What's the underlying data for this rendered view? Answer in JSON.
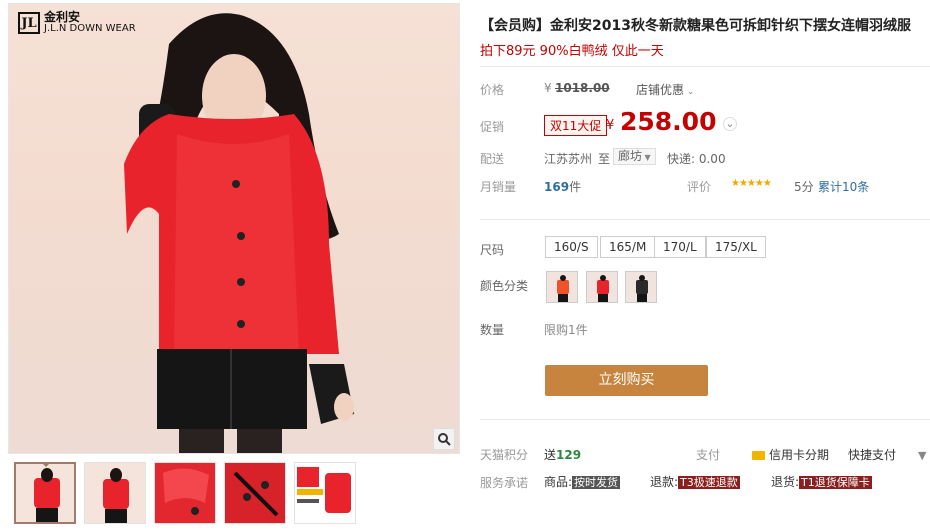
{
  "brand": {
    "mark": "JL",
    "cn": "金利安",
    "en": "J.L.N DOWN WEAR"
  },
  "title": "【会员购】金利安2013秋冬新款糖果色可拆卸针织下摆女连帽羽绒服",
  "subtitle": "拍下89元 90%白鸭绒 仅此一天",
  "price_row": {
    "label": "价格",
    "currency": "¥",
    "original": "1018.00",
    "shop_discount": "店铺优惠"
  },
  "promo_row": {
    "label": "促销",
    "badge": "双11大促",
    "currency": "¥",
    "price": "258.00"
  },
  "shipping": {
    "label": "配送",
    "from": "江苏苏州",
    "to_word": "至",
    "to": "廊坊",
    "fee": "快递: 0.00"
  },
  "monthly": {
    "label": "月销量",
    "count": "169",
    "unit": "件"
  },
  "rating": {
    "label": "评价",
    "stars": "★★★★★",
    "score": "5分",
    "total": "累计10条"
  },
  "sizes": {
    "label": "尺码",
    "options": [
      "160/S",
      "165/M",
      "170/L",
      "175/XL"
    ]
  },
  "colors": {
    "label": "颜色分类"
  },
  "quantity": {
    "label": "数量",
    "limit": "限购1件"
  },
  "buy_button": "立刻购买",
  "points": {
    "label": "天猫积分",
    "prefix": "送",
    "value": "129"
  },
  "pay": {
    "label": "支付",
    "credit": "信用卡分期",
    "quick": "快捷支付"
  },
  "service": {
    "label": "服务承诺",
    "goods": "商品:",
    "goods_tag": "按时发货",
    "refund": "退款:",
    "refund_tag": "T3极速退款",
    "return": "退货:",
    "return_tag": "T1退货保障卡"
  },
  "colors_hex": {
    "accent": "#c40000",
    "buy": "#c6843f"
  }
}
